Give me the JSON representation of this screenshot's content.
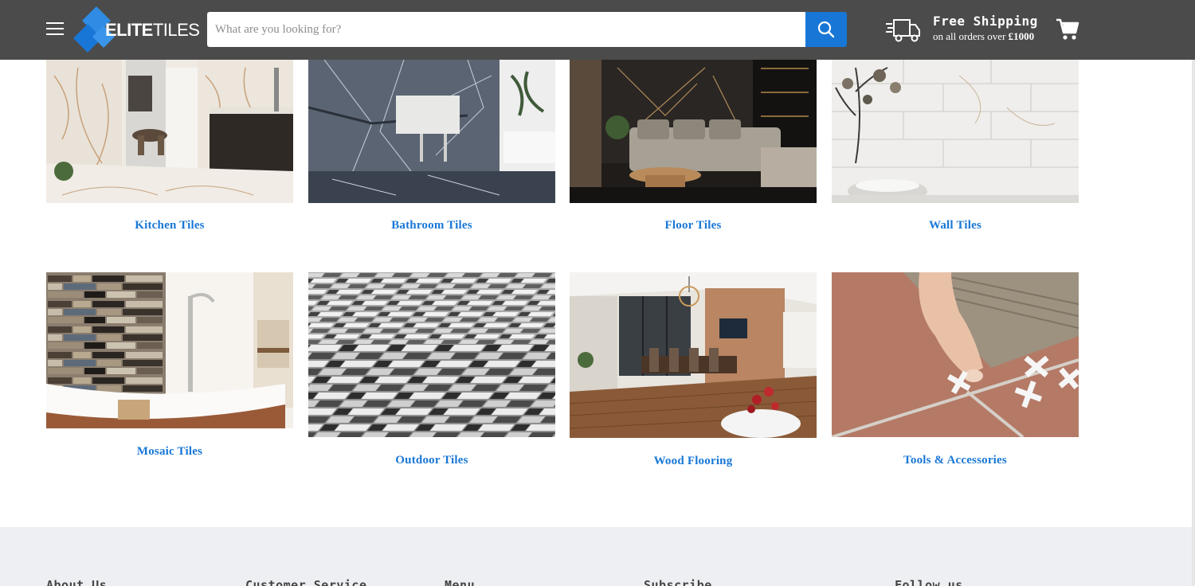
{
  "header": {
    "logo_bold": "ELITE",
    "logo_thin": "TILES",
    "search_placeholder": "What are you looking for?",
    "shipping_title": "Free Shipping",
    "shipping_sub_prefix": "on all orders over",
    "shipping_amount": "£1000",
    "accent": "#1877d6",
    "bar_color": "#4b4b4b"
  },
  "categories": [
    {
      "label": "Kitchen Tiles",
      "icon": "kitchen-tiles-image"
    },
    {
      "label": "Bathroom Tiles",
      "icon": "bathroom-tiles-image"
    },
    {
      "label": "Floor Tiles",
      "icon": "floor-tiles-image"
    },
    {
      "label": "Wall Tiles",
      "icon": "wall-tiles-image"
    },
    {
      "label": "Mosaic Tiles",
      "icon": "mosaic-tiles-image"
    },
    {
      "label": "Outdoor Tiles",
      "icon": "outdoor-tiles-image"
    },
    {
      "label": "Wood Flooring",
      "icon": "wood-flooring-image"
    },
    {
      "label": "Tools & Accessories",
      "icon": "tools-accessories-image"
    }
  ],
  "footer": {
    "headings": [
      "About Us",
      "Customer Service",
      "Menu",
      "Subscribe",
      "Follow us"
    ]
  }
}
